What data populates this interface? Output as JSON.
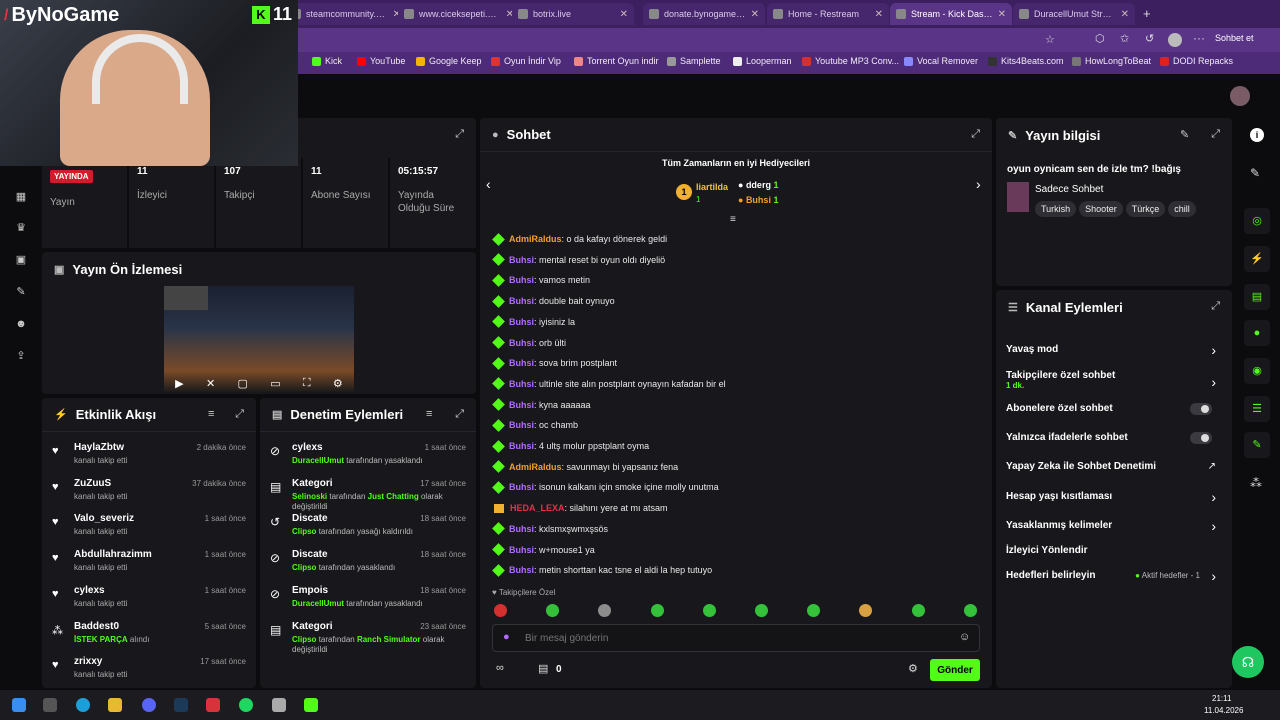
{
  "overlay": {
    "logo_text": "ByNoGame",
    "kick_count": "11"
  },
  "tabs": [
    {
      "label": "steamcommunity.com",
      "active": false
    },
    {
      "label": "www.ciceksepeti.com",
      "active": false
    },
    {
      "label": "botrix.live",
      "active": false
    },
    {
      "label": "donate.bynogame.com",
      "active": false
    },
    {
      "label": "Home - Restream",
      "active": false
    },
    {
      "label": "Stream - Kick Dashboard",
      "active": true
    },
    {
      "label": "DuracellUmut Stream",
      "active": false
    }
  ],
  "browser": {
    "profile_button": "Sohbet et"
  },
  "bookmarks": [
    "Kick",
    "YouTube",
    "Google Keep",
    "Oyun İndir Vip",
    "Torrent Oyun indir",
    "Samplette",
    "Looperman",
    "Youtube MP3 Conv...",
    "Vocal Remover",
    "Kits4Beats.com",
    "HowLongToBeat",
    "DODI Repacks"
  ],
  "stats": [
    {
      "value": "YAYINDA",
      "label": "Yayın"
    },
    {
      "value": "11",
      "label": "İzleyici"
    },
    {
      "value": "107",
      "label": "Takipçi"
    },
    {
      "value": "11",
      "label": "Abone Sayısı"
    },
    {
      "value": "05:15:57",
      "label": "Yayında Olduğu Süre"
    }
  ],
  "preview": {
    "title": "Yayın Ön İzlemesi"
  },
  "activity": {
    "title": "Etkinlik Akışı",
    "items": [
      {
        "name": "HaylaZbtw",
        "sub": "kanalı takip etti",
        "time": "2 dakika önce",
        "icon": "heart-icon"
      },
      {
        "name": "ZuZuuS",
        "sub": "kanalı takip etti",
        "time": "37 dakika önce",
        "icon": "heart-icon"
      },
      {
        "name": "Valo_severiz",
        "sub": "kanalı takip etti",
        "time": "1 saat önce",
        "icon": "heart-icon"
      },
      {
        "name": "Abdullahrazimm",
        "sub": "kanalı takip etti",
        "time": "1 saat önce",
        "icon": "heart-icon"
      },
      {
        "name": "cylexs",
        "sub": "kanalı takip etti",
        "time": "1 saat önce",
        "icon": "heart-icon"
      },
      {
        "name": "Baddest0",
        "sub_highlight": "İSTEK PARÇA",
        "sub": "alındı",
        "time": "5 saat önce",
        "icon": "points-icon"
      },
      {
        "name": "zrixxy",
        "sub": "kanalı takip etti",
        "time": "17 saat önce",
        "icon": "heart-icon"
      }
    ]
  },
  "moderation": {
    "title": "Denetim Eylemleri",
    "items": [
      {
        "name": "cylexs",
        "actor": "DuracellUmut",
        "text": "tarafından yasaklandı",
        "time": "1 saat önce",
        "icon": "ban-icon"
      },
      {
        "name": "Kategori",
        "actor": "Selinoski",
        "text": "tarafından",
        "extra": "Just Chatting",
        "text2": "olarak değiştirildi",
        "time": "17 saat önce",
        "icon": "category-icon"
      },
      {
        "name": "Discate",
        "actor": "Clipso",
        "text": "tarafından yasağı kaldırıldı",
        "time": "18 saat önce",
        "icon": "unban-icon"
      },
      {
        "name": "Discate",
        "actor": "Clipso",
        "text": "tarafından yasaklandı",
        "time": "18 saat önce",
        "icon": "ban-icon"
      },
      {
        "name": "Empois",
        "actor": "DuracellUmut",
        "text": "tarafından yasaklandı",
        "time": "18 saat önce",
        "icon": "ban-icon"
      },
      {
        "name": "Kategori",
        "actor": "Clipso",
        "text": "tarafından",
        "extra": "Ranch Simulator",
        "text2": "olarak değiştirildi",
        "time": "23 saat önce",
        "icon": "category-icon"
      }
    ]
  },
  "chat": {
    "title": "Sohbet",
    "gifters_title": "Tüm Zamanların en iyi Hediyecileri",
    "gifters": [
      {
        "name": "liartilda",
        "count": "1"
      },
      {
        "name": "dderg",
        "count": "1"
      },
      {
        "name": "Buhsi",
        "count": "1"
      }
    ],
    "messages": [
      {
        "user": "AdmiRaldus",
        "color": "#f0a030",
        "text": ": o da kafayı dönerek geldi"
      },
      {
        "user": "Buhsi",
        "color": "#b36bff",
        "text": ": mental reset bi oyun oldı diyeliö"
      },
      {
        "user": "Buhsi",
        "color": "#b36bff",
        "text": ": vamos metin"
      },
      {
        "user": "Buhsi",
        "color": "#b36bff",
        "text": ": double bait oynuyo"
      },
      {
        "user": "Buhsi",
        "color": "#b36bff",
        "text": ": iyisiniz la"
      },
      {
        "user": "Buhsi",
        "color": "#b36bff",
        "text": ": orb ülti"
      },
      {
        "user": "Buhsi",
        "color": "#b36bff",
        "text": ": sova brim postplant"
      },
      {
        "user": "Buhsi",
        "color": "#b36bff",
        "text": ": ultinle site alın postplant oynayın kafadan bir el"
      },
      {
        "user": "Buhsi",
        "color": "#b36bff",
        "text": ": kyna aaaaaa"
      },
      {
        "user": "Buhsi",
        "color": "#b36bff",
        "text": ": oc chamb"
      },
      {
        "user": "Buhsi",
        "color": "#b36bff",
        "text": ": 4 ultş molur ppstplant oyma"
      },
      {
        "user": "AdmiRaldus",
        "color": "#f0a030",
        "text": ": savunmayı bi yapsanız fena"
      },
      {
        "user": "Buhsi",
        "color": "#b36bff",
        "text": ": isonun kalkanı için smoke içine molly unutma"
      },
      {
        "user": "HEDA_LEXA",
        "color": "#e8304a",
        "text": ": silahını yere at mı atsam"
      },
      {
        "user": "Buhsi",
        "color": "#b36bff",
        "text": ": kxlsmxşwmxşsös"
      },
      {
        "user": "Buhsi",
        "color": "#b36bff",
        "text": ": w+mouse1 ya"
      },
      {
        "user": "Buhsi",
        "color": "#b36bff",
        "text": ": metin shorttan kac tsne el aldi la hep tutuyo"
      }
    ],
    "followers_only_note": "Takipçilere Özel",
    "input_placeholder": "Bir mesaj gönderin",
    "points_count": "0",
    "send_label": "Gönder"
  },
  "stream_info": {
    "title": "Yayın bilgisi",
    "stream_title": "oyun oynicam sen de izle tm? !bağış",
    "category": "Sadece Sohbet",
    "tags": [
      "Turkish",
      "Shooter",
      "Türkçe",
      "chill"
    ]
  },
  "channel_actions": {
    "title": "Kanal Eylemleri",
    "rows": [
      {
        "label": "Yavaş mod",
        "control": "chevron"
      },
      {
        "label": "Takipçilere özel sohbet",
        "sub": "1 dk.",
        "control": "chevron"
      },
      {
        "label": "Abonelere özel sohbet",
        "control": "toggle"
      },
      {
        "label": "Yalnızca ifadelerle sohbet",
        "control": "toggle"
      },
      {
        "label": "Yapay Zeka ile Sohbet Denetimi",
        "control": "external"
      },
      {
        "label": "Hesap yaşı kısıtlaması",
        "control": "chevron"
      },
      {
        "label": "Yasaklanmış kelimeler",
        "control": "chevron"
      },
      {
        "label": "İzleyici Yönlendir",
        "control": "none"
      },
      {
        "label": "Hedefleri belirleyin",
        "status": "Aktif hedefler - 1",
        "control": "chevron"
      }
    ]
  },
  "taskbar": {
    "time": "21:11",
    "date": "11.04.2026"
  },
  "colors": {
    "kick_green": "#53fc18",
    "browser_purple": "#5a3487",
    "panel_bg": "#18181c"
  }
}
